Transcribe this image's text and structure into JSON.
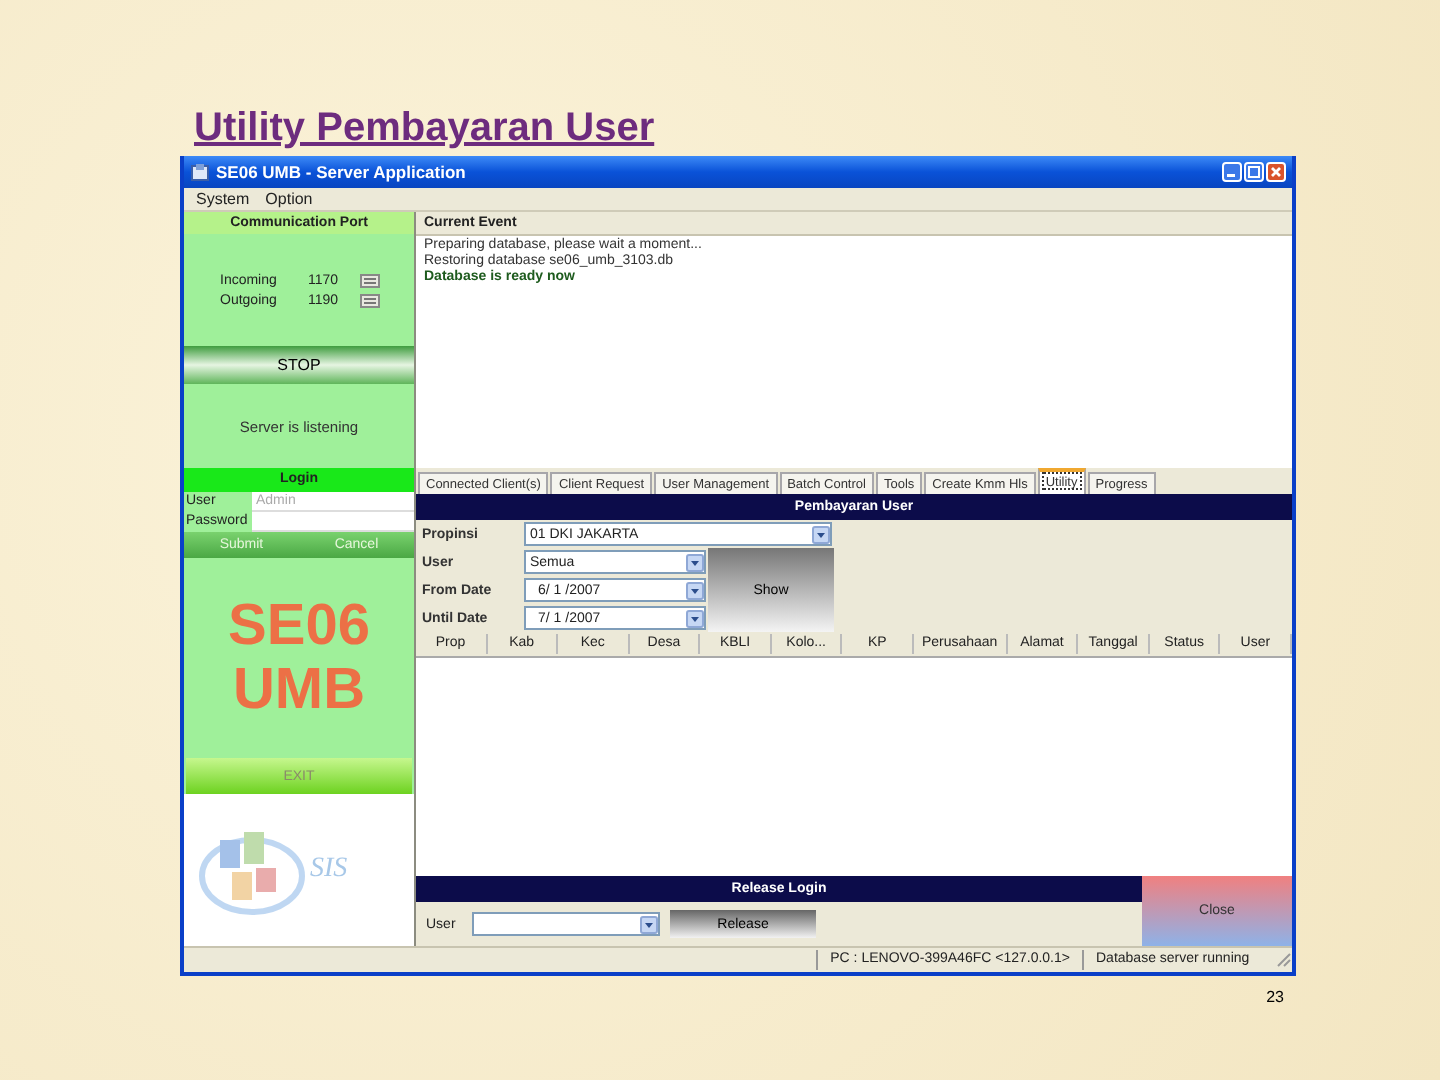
{
  "slide_title": "Utility Pembayaran User",
  "window": {
    "title": "SE06 UMB - Server Application"
  },
  "menu": [
    "System",
    "Option"
  ],
  "communication_port": {
    "header": "Communication Port",
    "ports": [
      {
        "label": "Incoming",
        "value": "1170"
      },
      {
        "label": "Outgoing",
        "value": "1190"
      }
    ],
    "stop_button": "STOP",
    "status": "Server is listening"
  },
  "login": {
    "header": "Login",
    "fields": [
      {
        "label": "User",
        "placeholder": "Admin"
      },
      {
        "label": "Password"
      }
    ],
    "buttons": [
      "Submit",
      "Cancel"
    ]
  },
  "brand": {
    "lines": [
      "SE06",
      "UMB"
    ],
    "logo_text": "SIS"
  },
  "exit_button": "EXIT",
  "current_event": {
    "header": "Current Event",
    "lines": [
      {
        "text": "Preparing database, please wait a moment...",
        "highlighted": false
      },
      {
        "text": "Restoring database se06_umb_3103.db",
        "highlighted": false
      },
      {
        "text": "Database is ready now",
        "highlighted": true
      }
    ]
  },
  "tabs": [
    {
      "label": "Connected Client(s)",
      "selected": false
    },
    {
      "label": "Client Request",
      "selected": false
    },
    {
      "label": "User Management",
      "selected": false
    },
    {
      "label": "Batch Control",
      "selected": false
    },
    {
      "label": "Tools",
      "selected": false
    },
    {
      "label": "Create Kmm Hls",
      "selected": false
    },
    {
      "label": "Utility",
      "selected": true
    },
    {
      "label": "Progress",
      "selected": false
    }
  ],
  "pembayaran_user": {
    "header": "Pembayaran User",
    "fields": [
      {
        "label": "Propinsi",
        "value": "01 DKI JAKARTA",
        "kind": "combo"
      },
      {
        "label": "User",
        "value": "Semua",
        "kind": "combo"
      },
      {
        "label": "From Date",
        "value": "6/ 1 /2007",
        "kind": "date"
      },
      {
        "label": "Until Date",
        "value": "7/ 1 /2007",
        "kind": "date"
      }
    ],
    "show_button": "Show",
    "table": {
      "columns": [
        "Prop",
        "Kab",
        "Kec",
        "Desa",
        "KBLI",
        "Kolo...",
        "KP",
        "Perusahaan",
        "Alamat",
        "Tanggal",
        "Status",
        "User"
      ]
    }
  },
  "release_login": {
    "header": "Release Login",
    "user_label": "User",
    "release_button": "Release",
    "close_button": "Close"
  },
  "status_bar": [
    "PC : LENOVO-399A46FC <127.0.0.1>",
    "Database server running"
  ],
  "page_number": "23"
}
